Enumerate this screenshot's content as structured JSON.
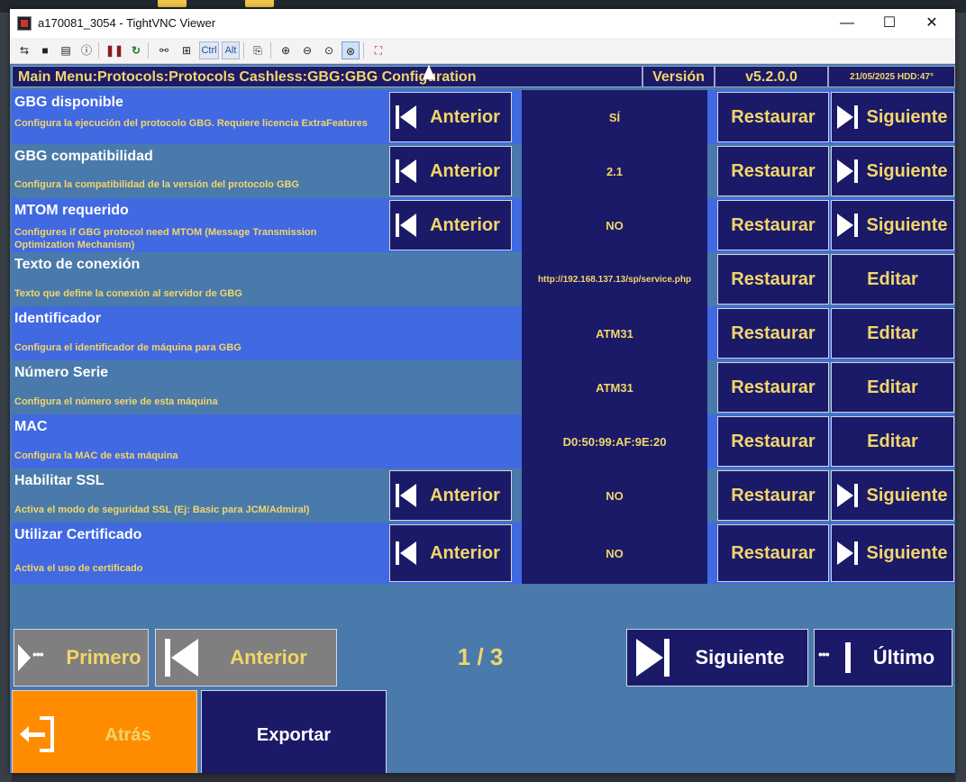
{
  "window": {
    "title": "a170081_3054 - TightVNC Viewer",
    "minimize": "—",
    "maximize": "☐",
    "close": "✕"
  },
  "toolbar": {
    "ctrl": "Ctrl",
    "alt": "Alt"
  },
  "header": {
    "breadcrumb": "Main Menu:Protocols:Protocols Cashless:GBG:GBG Configuration",
    "version_label": "Versión",
    "version_value": "v5.2.0.0",
    "status": "21/05/2025  HDD:47°"
  },
  "buttons": {
    "prev": "Anterior",
    "next": "Siguiente",
    "restore": "Restaurar",
    "edit": "Editar"
  },
  "rows": [
    {
      "title": "GBG disponible",
      "desc": "Configura la ejecución del protocolo GBG. Requiere licencia ExtraFeatures",
      "value": "SÍ"
    },
    {
      "title": "GBG compatibilidad",
      "desc": "Configura la compatibilidad de la versión del protocolo GBG",
      "value": "2.1"
    },
    {
      "title": "MTOM requerido",
      "desc": "Configures if GBG protocol need MTOM (Message Transmission Optimization Mechanism)",
      "value": "NO"
    },
    {
      "title": "Texto de conexión",
      "desc": "Texto que define la conexión al servidor de GBG",
      "value": "http://192.168.137.13/sp/service.php"
    },
    {
      "title": "Identificador",
      "desc": "Configura el identificador de máquina para GBG",
      "value": "ATM31"
    },
    {
      "title": "Número Serie",
      "desc": "Configura el número serie de esta máquina",
      "value": "ATM31"
    },
    {
      "title": "MAC",
      "desc": "Configura la MAC de esta máquina",
      "value": "D0:50:99:AF:9E:20"
    },
    {
      "title": "Habilitar SSL",
      "desc": "Activa el modo de seguridad SSL (Ej: Basic para JCM/Admiral)",
      "value": "NO"
    },
    {
      "title": "Utilizar Certificado",
      "desc": "Activa el uso de certificado",
      "value": "NO"
    }
  ],
  "nav": {
    "first": "Primero",
    "prev": "Anterior",
    "page": "1 / 3",
    "next": "Siguiente",
    "last": "Último",
    "back": "Atrás",
    "export": "Exportar"
  },
  "colors": {
    "navy": "#1b1a68",
    "royal": "#4169e1",
    "steel": "#4a7aab",
    "gold": "#f2d66a",
    "orange": "#ff8c00",
    "grey": "#7f7f7f"
  }
}
